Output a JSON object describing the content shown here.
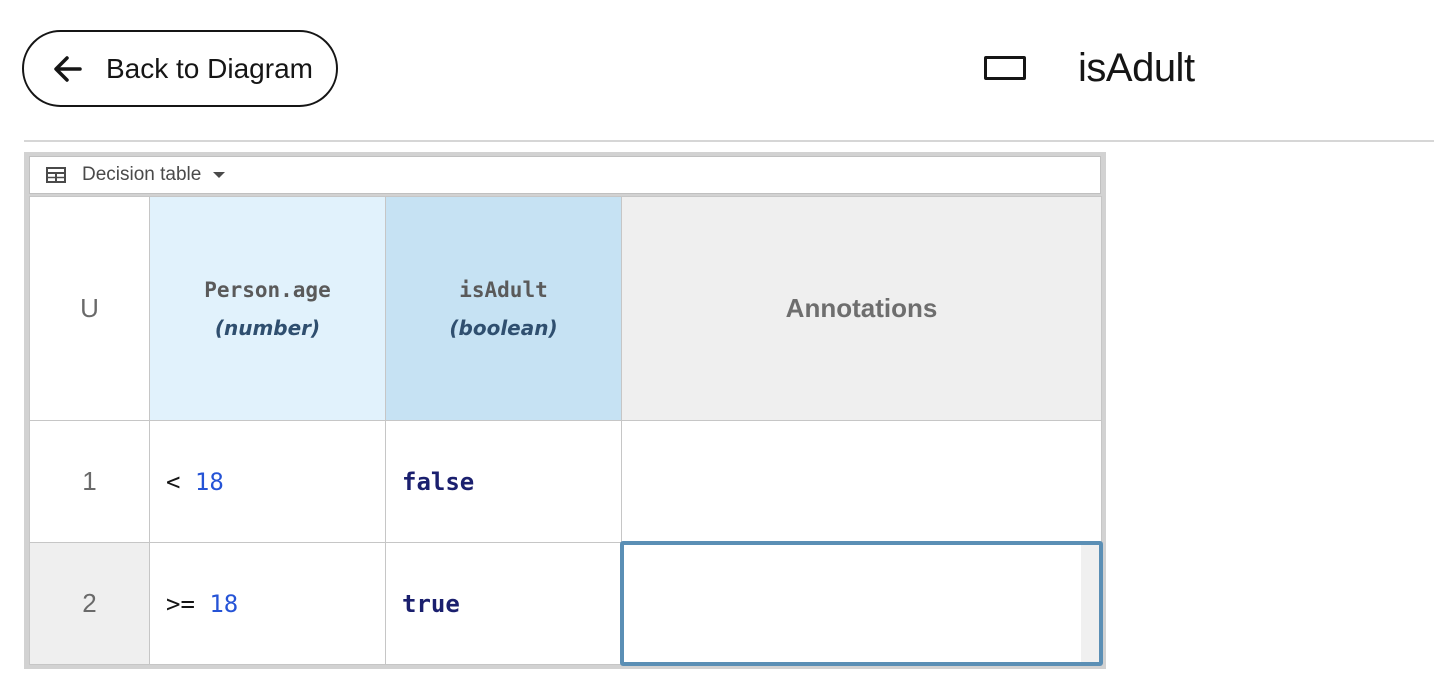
{
  "header": {
    "back_label": "Back to Diagram",
    "title": "isAdult",
    "back_icon": "arrow-left-icon",
    "title_icon": "decision-rectangle-icon"
  },
  "decision_table": {
    "type_label": "Decision table",
    "hit_policy": "U",
    "input_column": {
      "name": "Person.age",
      "type": "(number)"
    },
    "output_column": {
      "name": "isAdult",
      "type": "(boolean)"
    },
    "annotations_label": "Annotations",
    "rows": [
      {
        "num": "1",
        "input_op": "<",
        "input_num": "18",
        "output": "false",
        "annotation": ""
      },
      {
        "num": "2",
        "input_op": ">=",
        "input_num": "18",
        "output": "true",
        "annotation": ""
      }
    ]
  },
  "colors": {
    "input_header": "#e1f2fc",
    "output_header": "#c6e2f3",
    "selection": "#5b8fb5",
    "number": "#2553d6",
    "keyword": "#1a1f6e"
  }
}
